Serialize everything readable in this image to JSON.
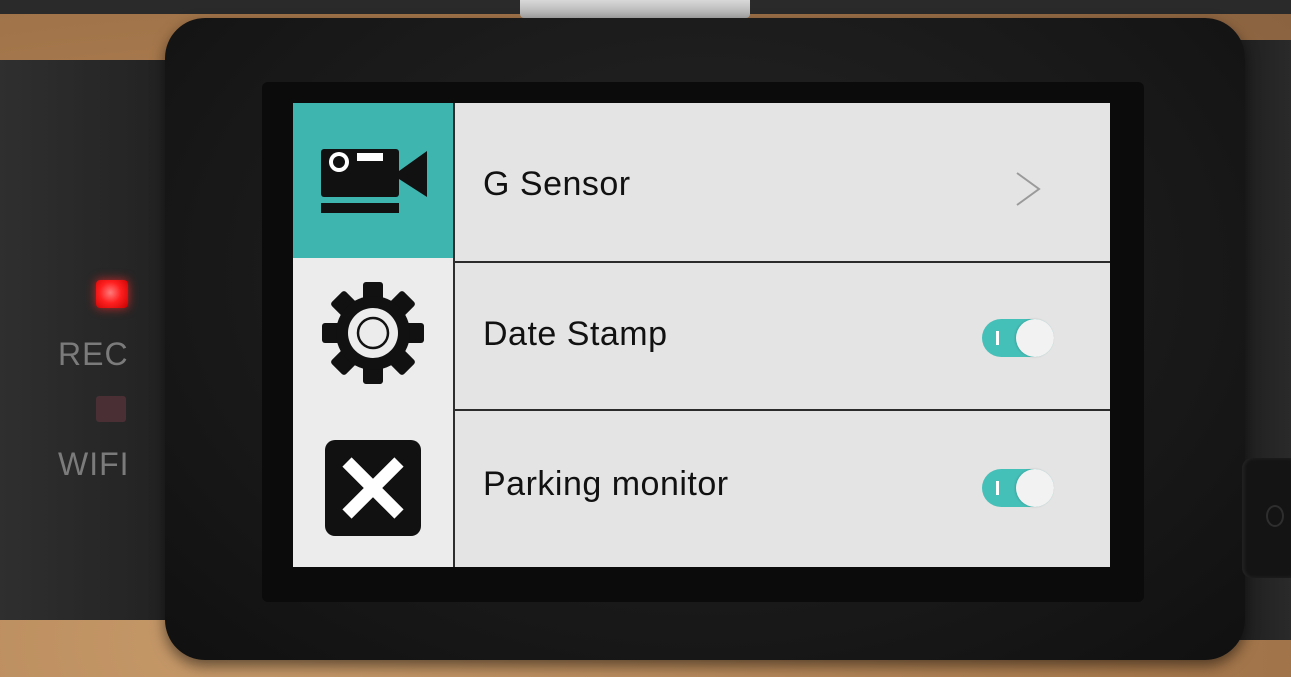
{
  "device": {
    "indicators": {
      "rec_label": "REC",
      "wifi_label": "WIFI",
      "rec_led_color": "#ff2020",
      "wifi_led_color": "#4a3034"
    }
  },
  "sidebar": {
    "tabs": [
      {
        "icon": "video-camera-icon",
        "selected": true
      },
      {
        "icon": "gear-icon",
        "selected": false
      },
      {
        "icon": "close-icon",
        "selected": false
      }
    ],
    "accent_color": "#3fb5b0"
  },
  "menu": {
    "items": [
      {
        "label": "G Sensor",
        "control": "chevron-right-icon"
      },
      {
        "label": "Date Stamp",
        "control": "toggle",
        "on": true
      },
      {
        "label": "Parking monitor",
        "control": "toggle",
        "on": true
      }
    ],
    "toggle_color": "#45c0b9"
  }
}
